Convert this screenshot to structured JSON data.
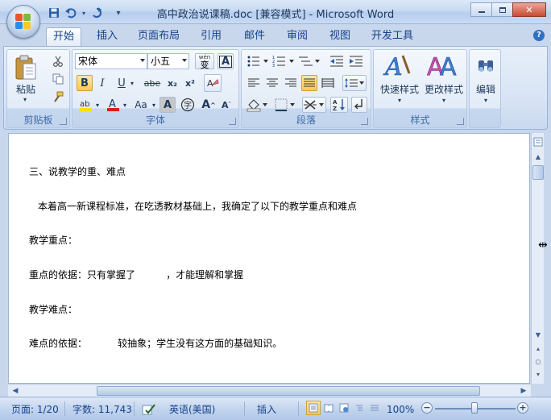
{
  "window": {
    "title": "高中政治说课稿.doc [兼容模式] - Microsoft Word",
    "minimize": "▭",
    "restore": "❐",
    "close": "✕"
  },
  "qat": {
    "save_icon": "floppy-icon",
    "undo_icon": "undo-icon",
    "redo_icon": "redo-icon",
    "customize": "▾"
  },
  "tabs": [
    {
      "label": "开始",
      "active": true
    },
    {
      "label": "插入"
    },
    {
      "label": "页面布局"
    },
    {
      "label": "引用"
    },
    {
      "label": "邮件"
    },
    {
      "label": "审阅"
    },
    {
      "label": "视图"
    },
    {
      "label": "开发工具"
    }
  ],
  "ribbon": {
    "clipboard": {
      "label": "剪贴板",
      "paste": "粘贴"
    },
    "font": {
      "label": "字体",
      "font_name": "宋体",
      "font_size": "小五",
      "wen_label": "wén",
      "wen_char": "变",
      "bold": "B",
      "italic": "I",
      "underline": "U",
      "strike": "abe",
      "subscript": "x₂",
      "superscript": "x²",
      "aa": "Aa",
      "grow": "A",
      "shrink": "A"
    },
    "paragraph": {
      "label": "段落"
    },
    "styles": {
      "label": "样式",
      "quick_styles": "快速样式",
      "change_styles": "更改样式"
    },
    "editing": {
      "label": "编辑"
    }
  },
  "document": {
    "paragraphs": [
      "三、说教学的重、难点",
      "本着高一新课程标准，在吃透教材基础上，我确定了以下的教学重点和难点",
      "教学重点：",
      "重点的依据：只有掌握了          ，才能理解和掌握",
      "教学难点：",
      "难点的依据：          较抽象；学生没有这方面的基础知识。"
    ]
  },
  "statusbar": {
    "page": "页面: 1/20",
    "words": "字数: 11,743",
    "language": "英语(美国)",
    "mode": "插入",
    "zoom": "100%",
    "zoom_minus": "−",
    "zoom_plus": "+"
  }
}
